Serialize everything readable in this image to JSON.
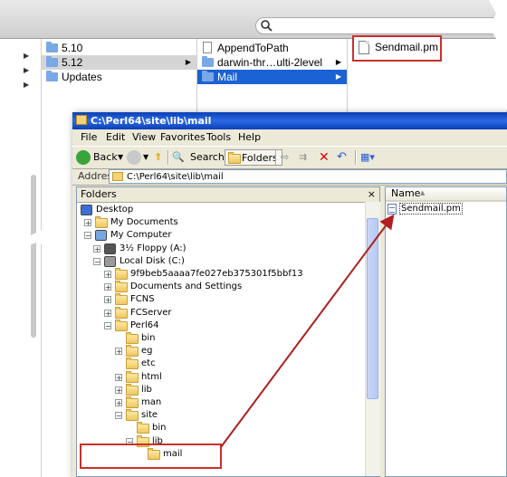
{
  "finder": {
    "search_placeholder": "",
    "column1": [
      {
        "label": "5.10",
        "selected": false,
        "gray": false,
        "has_children": true
      },
      {
        "label": "5.12",
        "selected": false,
        "gray": true,
        "has_children": true
      },
      {
        "label": "Updates",
        "selected": false,
        "gray": false,
        "has_children": true
      }
    ],
    "column2": [
      {
        "label": "AppendToPath",
        "type": "file"
      },
      {
        "label": "darwin-thr…ulti-2level",
        "type": "folder"
      },
      {
        "label": "Mail",
        "type": "folder",
        "selected": true
      }
    ],
    "column3": [
      {
        "label": "Sendmail.pm",
        "type": "file"
      }
    ]
  },
  "explorer": {
    "title": "C:\\Perl64\\site\\lib\\mail",
    "menu": [
      "File",
      "Edit",
      "View",
      "Favorites",
      "Tools",
      "Help"
    ],
    "toolbar": {
      "back": "Back",
      "search": "Search",
      "folders": "Folders"
    },
    "address_label": "Address",
    "address_value": "C:\\Perl64\\site\\lib\\mail",
    "folders_title": "Folders",
    "close_glyph": "×",
    "tree": [
      {
        "label": "Desktop",
        "depth": 0,
        "expander": "",
        "icon": "desktop"
      },
      {
        "label": "My Documents",
        "depth": 1,
        "expander": "+",
        "icon": "folder"
      },
      {
        "label": "My Computer",
        "depth": 1,
        "expander": "-",
        "icon": "computer"
      },
      {
        "label": "3½ Floppy (A:)",
        "depth": 2,
        "expander": "+",
        "icon": "floppy"
      },
      {
        "label": "Local Disk (C:)",
        "depth": 2,
        "expander": "-",
        "icon": "disk"
      },
      {
        "label": "9f9beb5aaaa7fe027eb375301f5bbf13",
        "depth": 3,
        "expander": "+",
        "icon": "folder"
      },
      {
        "label": "Documents and Settings",
        "depth": 3,
        "expander": "+",
        "icon": "folder"
      },
      {
        "label": "FCNS",
        "depth": 3,
        "expander": "+",
        "icon": "folder"
      },
      {
        "label": "FCServer",
        "depth": 3,
        "expander": "+",
        "icon": "folder"
      },
      {
        "label": "Perl64",
        "depth": 3,
        "expander": "-",
        "icon": "folder"
      },
      {
        "label": "bin",
        "depth": 4,
        "expander": "",
        "icon": "folder"
      },
      {
        "label": "eg",
        "depth": 4,
        "expander": "+",
        "icon": "folder"
      },
      {
        "label": "etc",
        "depth": 4,
        "expander": "",
        "icon": "folder"
      },
      {
        "label": "html",
        "depth": 4,
        "expander": "+",
        "icon": "folder"
      },
      {
        "label": "lib",
        "depth": 4,
        "expander": "+",
        "icon": "folder"
      },
      {
        "label": "man",
        "depth": 4,
        "expander": "+",
        "icon": "folder"
      },
      {
        "label": "site",
        "depth": 4,
        "expander": "-",
        "icon": "folder"
      },
      {
        "label": "bin",
        "depth": 5,
        "expander": "",
        "icon": "folder"
      },
      {
        "label": "lib",
        "depth": 5,
        "expander": "-",
        "icon": "folder"
      },
      {
        "label": "mail",
        "depth": 6,
        "expander": "",
        "icon": "folder",
        "selected": true
      }
    ],
    "files_header": "Name",
    "files_sort_glyph": "▲",
    "files": [
      "Sendmail.pm"
    ]
  },
  "colors": {
    "mac_selection": "#1b62d4",
    "xp_title": "#0a3fb4",
    "highlight_box": "#c9302c"
  }
}
